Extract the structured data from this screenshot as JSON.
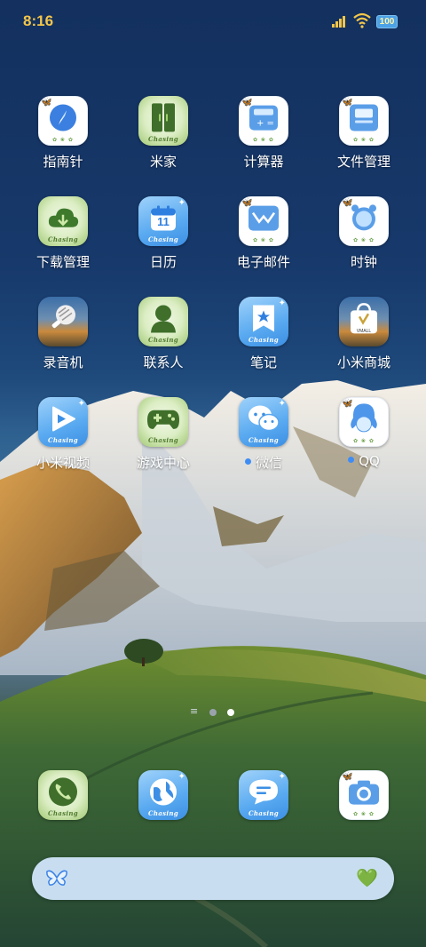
{
  "status_bar": {
    "time": "8:16",
    "battery": "100"
  },
  "colors": {
    "clock": "#f3c64a",
    "notification_dot": "#3f8cf5",
    "search_bar": "#c8def0"
  },
  "watermark": "Chasing",
  "apps": [
    {
      "label": "指南针",
      "icon": "compass-icon",
      "style": "white",
      "dot": false
    },
    {
      "label": "米家",
      "icon": "mijia-icon",
      "style": "green",
      "dot": false
    },
    {
      "label": "计算器",
      "icon": "calculator-icon",
      "style": "white",
      "dot": false
    },
    {
      "label": "文件管理",
      "icon": "file-manager-icon",
      "style": "white",
      "dot": false
    },
    {
      "label": "下载管理",
      "icon": "download-cloud-icon",
      "style": "green",
      "dot": false
    },
    {
      "label": "日历",
      "icon": "calendar-icon",
      "style": "blue",
      "dot": false,
      "day": "11"
    },
    {
      "label": "电子邮件",
      "icon": "email-icon",
      "style": "white",
      "dot": false
    },
    {
      "label": "时钟",
      "icon": "alarm-clock-icon",
      "style": "white",
      "dot": false
    },
    {
      "label": "录音机",
      "icon": "microphone-icon",
      "style": "photo",
      "dot": false
    },
    {
      "label": "联系人",
      "icon": "contact-person-icon",
      "style": "green",
      "dot": false
    },
    {
      "label": "笔记",
      "icon": "notes-icon",
      "style": "blue",
      "dot": false
    },
    {
      "label": "小米商城",
      "icon": "mall-bag-icon",
      "style": "photo",
      "dot": false,
      "brand": "VMALL"
    },
    {
      "label": "小米视频",
      "icon": "video-play-icon",
      "style": "blue",
      "dot": false
    },
    {
      "label": "游戏中心",
      "icon": "gamepad-icon",
      "style": "green",
      "dot": false
    },
    {
      "label": "微信",
      "icon": "wechat-icon",
      "style": "blue",
      "dot": true
    },
    {
      "label": "QQ",
      "icon": "qq-penguin-icon",
      "style": "white",
      "dot": true
    }
  ],
  "dock": [
    {
      "icon": "phone-call-icon",
      "style": "green"
    },
    {
      "icon": "browser-globe-icon",
      "style": "blue"
    },
    {
      "icon": "messages-icon",
      "style": "blue"
    },
    {
      "icon": "camera-icon",
      "style": "white"
    }
  ],
  "page_indicator": {
    "pages": 2,
    "current_page": 2
  },
  "search_bar": {
    "left_icon": "butterfly-icon",
    "right_icon": "green-heart-icon"
  }
}
